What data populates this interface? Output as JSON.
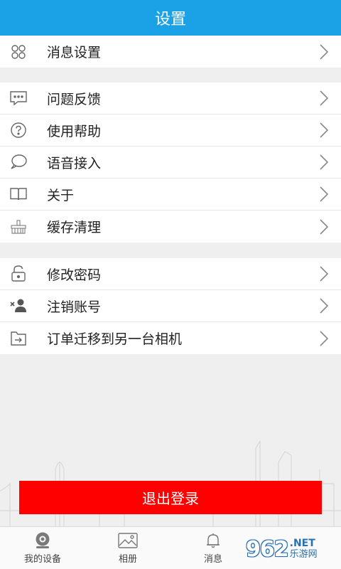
{
  "header": {
    "title": "设置"
  },
  "groups": [
    {
      "items": [
        {
          "label": "消息设置",
          "icon": "grid-icon"
        }
      ]
    },
    {
      "items": [
        {
          "label": "问题反馈",
          "icon": "chat-icon"
        },
        {
          "label": "使用帮助",
          "icon": "help-icon"
        },
        {
          "label": "语音接入",
          "icon": "speech-bubble-icon"
        },
        {
          "label": "关于",
          "icon": "book-icon"
        },
        {
          "label": "缓存清理",
          "icon": "broom-icon"
        }
      ]
    },
    {
      "items": [
        {
          "label": "修改密码",
          "icon": "lock-icon"
        },
        {
          "label": "注销账号",
          "icon": "remove-user-icon"
        },
        {
          "label": "订单迁移到另一台相机",
          "icon": "transfer-icon"
        }
      ]
    }
  ],
  "logout_button": {
    "label": "退出登录",
    "color": "#fe0000"
  },
  "tabbar": [
    {
      "label": "我的设备",
      "icon": "camera-icon"
    },
    {
      "label": "相册",
      "icon": "photo-icon"
    },
    {
      "label": "消息",
      "icon": "bell-icon"
    }
  ],
  "watermark": {
    "number": "962",
    "net": ".NET",
    "text": "乐游网"
  },
  "colors": {
    "header_bg": "#1aa1e6",
    "logout_bg": "#fe0000"
  }
}
